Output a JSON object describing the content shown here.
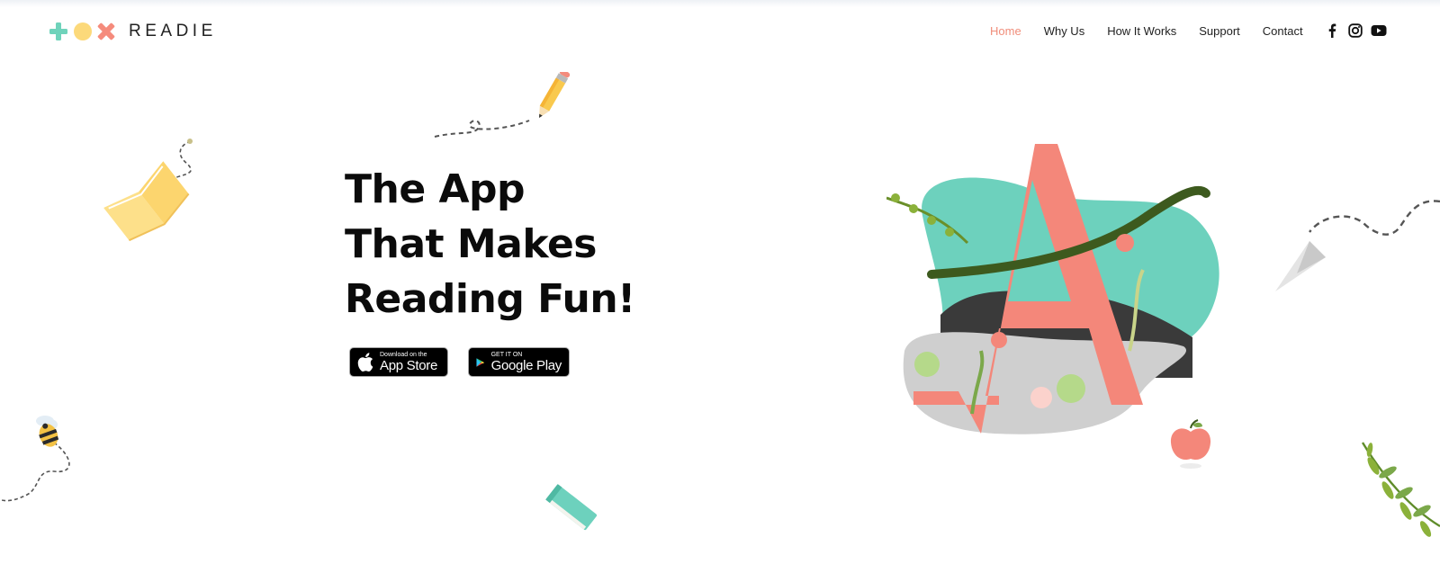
{
  "brand": {
    "name": "READIE",
    "logo_colors": {
      "plus": "#6fd3bb",
      "circle": "#fcd97a",
      "cross": "#f58b7c"
    }
  },
  "nav": {
    "items": [
      {
        "label": "Home",
        "active": true
      },
      {
        "label": "Why Us",
        "active": false
      },
      {
        "label": "How It Works",
        "active": false
      },
      {
        "label": "Support",
        "active": false
      },
      {
        "label": "Contact",
        "active": false
      }
    ],
    "active_color": "#f08d7a",
    "socials": [
      "facebook-icon",
      "instagram-icon",
      "youtube-icon"
    ]
  },
  "hero": {
    "headline": [
      "The App",
      "That Makes",
      "Reading Fun!"
    ],
    "buttons": {
      "appstore": {
        "small": "Download on the",
        "big": "App Store"
      },
      "googleplay": {
        "small": "GET IT ON",
        "big": "Google Play"
      }
    }
  },
  "illustrations": [
    "pencil-illustration",
    "open-book-illustration",
    "bee-illustration",
    "closed-book-illustration",
    "letter-a-illustration",
    "paper-plane-illustration",
    "apple-illustration",
    "leaf-branch-illustration"
  ],
  "colors": {
    "teal": "#6dd1bd",
    "salmon": "#f4877a",
    "yellow": "#fde08a",
    "grey": "#cfcfcf"
  }
}
